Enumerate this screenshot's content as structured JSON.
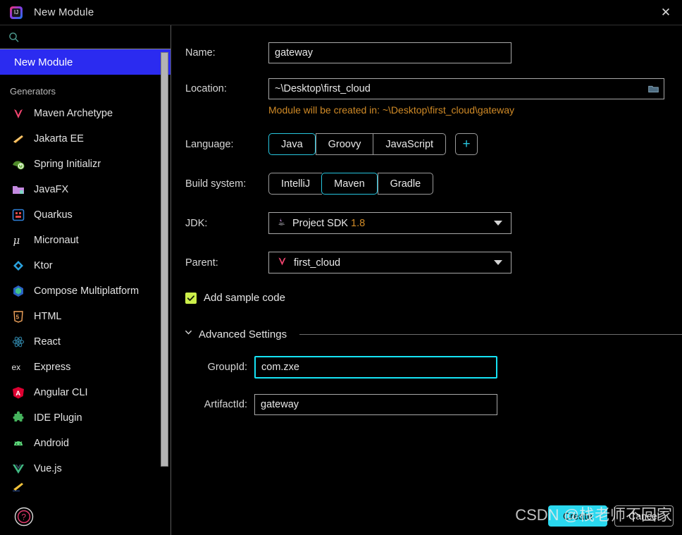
{
  "window": {
    "title": "New Module",
    "app_icon": "intellij-idea-icon",
    "close_label": "✕"
  },
  "sidebar": {
    "search": {
      "value": "",
      "placeholder": "",
      "icon": "search-icon"
    },
    "selected_item": {
      "label": "New Module"
    },
    "group_label": "Generators",
    "items": [
      {
        "label": "Maven Archetype",
        "icon": "maven-icon"
      },
      {
        "label": "Jakarta EE",
        "icon": "jakarta-ee-icon"
      },
      {
        "label": "Spring Initializr",
        "icon": "spring-icon"
      },
      {
        "label": "JavaFX",
        "icon": "javafx-icon"
      },
      {
        "label": "Quarkus",
        "icon": "quarkus-icon"
      },
      {
        "label": "Micronaut",
        "icon": "micronaut-icon"
      },
      {
        "label": "Ktor",
        "icon": "ktor-icon"
      },
      {
        "label": "Compose Multiplatform",
        "icon": "compose-icon"
      },
      {
        "label": "HTML",
        "icon": "html5-icon"
      },
      {
        "label": "React",
        "icon": "react-icon"
      },
      {
        "label": "Express",
        "icon": "express-icon"
      },
      {
        "label": "Angular CLI",
        "icon": "angular-icon"
      },
      {
        "label": "IDE Plugin",
        "icon": "plugin-icon"
      },
      {
        "label": "Android",
        "icon": "android-icon"
      },
      {
        "label": "Vue.js",
        "icon": "vue-icon"
      }
    ],
    "help_button": {
      "icon": "help-icon"
    }
  },
  "form": {
    "name": {
      "label": "Name:",
      "value": "gateway",
      "placeholder": ""
    },
    "location": {
      "label": "Location:",
      "value": "~\\Desktop\\first_cloud",
      "placeholder": "",
      "browse_icon": "folder-icon"
    },
    "location_hint": "Module will be created in: ~\\Desktop\\first_cloud\\gateway",
    "language": {
      "label": "Language:",
      "options": [
        "Java",
        "Groovy",
        "JavaScript"
      ],
      "selected": "Java",
      "add_button": "+"
    },
    "build_system": {
      "label": "Build system:",
      "options": [
        "IntelliJ",
        "Maven",
        "Gradle"
      ],
      "selected": "Maven"
    },
    "jdk": {
      "label": "JDK:",
      "value_prefix": "Project SDK",
      "value_version": "1.8",
      "icon": "java-icon"
    },
    "parent": {
      "label": "Parent:",
      "value": "first_cloud",
      "icon": "maven-icon"
    },
    "add_sample_code": {
      "label": "Add sample code",
      "checked": true
    },
    "advanced": {
      "title": "Advanced Settings",
      "expanded": true,
      "group_id": {
        "label": "GroupId:",
        "value": "com.zxe",
        "focused": true
      },
      "artifact_id": {
        "label": "ArtifactId:",
        "value": "gateway",
        "focused": false
      }
    }
  },
  "footer": {
    "create_label": "Create",
    "cancel_label": "Cancel"
  },
  "watermark": {
    "text": "CSDN @栈老师不回家"
  },
  "colors": {
    "accent_cyan": "#27c5de",
    "focus_cyan": "#15e3f5",
    "selection_blue": "#2b2bf0",
    "hint_orange": "#d08a26",
    "checkbox_green": "#ccef4a",
    "background": "#000000"
  }
}
